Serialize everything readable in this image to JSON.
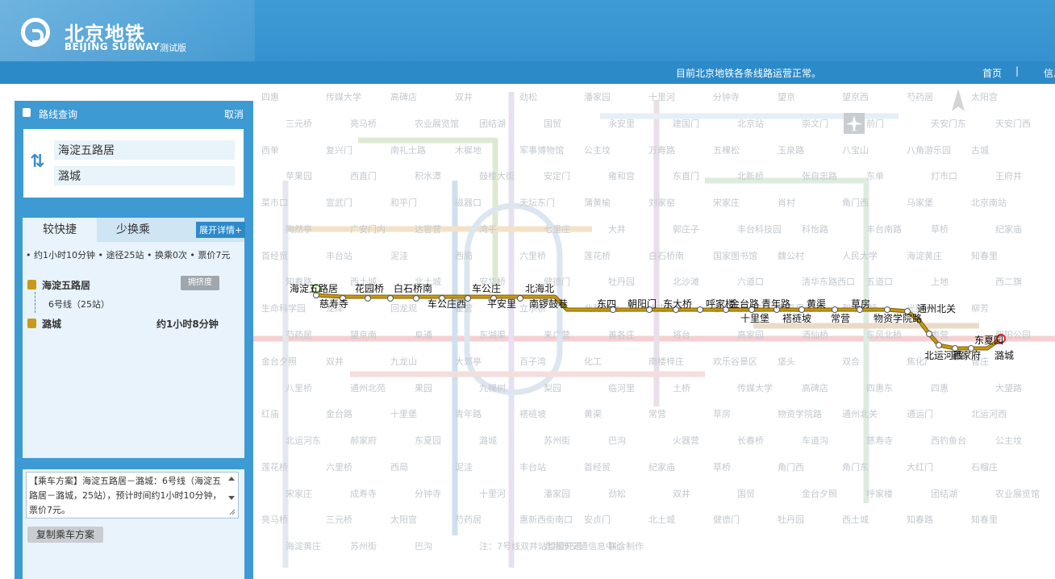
{
  "header": {
    "logo_cn": "北京地铁",
    "logo_en": "BEIJING SUBWAY",
    "logo_beta": "测试版",
    "status": "目前北京地铁各条线路运营正常。",
    "nav": {
      "home": "首页",
      "separator": "|",
      "info": "信息"
    }
  },
  "sidebar": {
    "title": "路线查询",
    "cancel": "取消",
    "from_value": "海淀五路居",
    "to_value": "潞城",
    "tabs": [
      {
        "label": "较快捷"
      },
      {
        "label": "少换乘"
      }
    ],
    "expand": "展开详情+",
    "summary": "• 约1小时10分钟 • 途径25站 • 换乘0次 • 票价7元",
    "route": {
      "from": "海淀五路居",
      "crowd": "拥挤度",
      "line": "6号线（25站）",
      "to": "潞城",
      "duration": "约1小时8分钟"
    },
    "plan_text": "【乘车方案】海淀五路居－潞城：6号线（海淀五路居－潞城，25站），预计时间约1小时10分钟，票价7元。",
    "copy_button": "复制乘车方案"
  },
  "map": {
    "line_color": "#c49a14",
    "stations": [
      "海淀五路居",
      "慈寿寺",
      "花园桥",
      "白石桥南",
      "车公庄西",
      "车公庄",
      "平安里",
      "北海北",
      "南锣鼓巷",
      "东四",
      "朝阳门",
      "东大桥",
      "呼家楼",
      "金台路",
      "十里堡",
      "青年路",
      "褡裢坡",
      "黄渠",
      "常营",
      "草房",
      "物资学院路",
      "通州北关",
      "北运河西",
      "郝家府",
      "东夏园",
      "潞城"
    ],
    "background_labels": [
      "四惠",
      "传媒大学",
      "高碑店",
      "双井",
      "劲松",
      "潘家园",
      "十里河",
      "分钟寺",
      "望京",
      "望京西",
      "芍药居",
      "太阳宫",
      "三元桥",
      "亮马桥",
      "农业展览馆",
      "团结湖",
      "国贸",
      "永安里",
      "建国门",
      "北京站",
      "崇文门",
      "前门",
      "天安门东",
      "天安门西",
      "西单",
      "复兴门",
      "南礼士路",
      "木樨地",
      "军事博物馆",
      "公主坟",
      "万寿路",
      "五棵松",
      "玉泉路",
      "八宝山",
      "八角游乐园",
      "古城",
      "苹果园",
      "西直门",
      "积水潭",
      "鼓楼大街",
      "安定门",
      "雍和宫",
      "东直门",
      "北新桥",
      "张自忠路",
      "东单",
      "灯市口",
      "王府井",
      "菜市口",
      "宣武门",
      "和平门",
      "磁器口",
      "天坛东门",
      "蒲黄榆",
      "刘家窑",
      "宋家庄",
      "肖村",
      "角门西",
      "马家堡",
      "北京南站",
      "陶然亭",
      "广安门内",
      "达官营",
      "湾子",
      "七里庄",
      "大井",
      "郭庄子",
      "丰台科技园",
      "科怡路",
      "丰台南路",
      "草桥",
      "纪家庙",
      "首经贸",
      "丰台站",
      "泥洼",
      "西局",
      "六里桥",
      "莲花桥",
      "白石桥南",
      "国家图书馆",
      "魏公村",
      "人民大学",
      "海淀黄庄",
      "知春里",
      "知春路",
      "西土城",
      "北土城",
      "安华桥",
      "健德门",
      "牡丹园",
      "北沙滩",
      "六道口",
      "清华东路西口",
      "五道口",
      "上地",
      "西二旗",
      "生命科学园",
      "龙泽",
      "回龙观",
      "霍营",
      "立水桥",
      "北苑路北",
      "大屯路东",
      "惠新西街北口",
      "和平里北街",
      "和平西桥",
      "光熙门",
      "柳芳",
      "芍药居",
      "望京南",
      "阜通",
      "东湖渠",
      "来广营",
      "善各庄",
      "将台",
      "高家园",
      "酒仙桥",
      "东风北桥",
      "枣营",
      "朝阳公园",
      "金台夕照",
      "双井",
      "九龙山",
      "大郊亭",
      "百子湾",
      "化工",
      "南楼梓庄",
      "欢乐谷景区",
      "垡头",
      "双合",
      "焦化厂",
      "管庄",
      "八里桥",
      "通州北苑",
      "果园",
      "九棵树",
      "梨园",
      "临河里",
      "土桥",
      "传媒大学",
      "高碑店",
      "四惠东",
      "四惠",
      "大望路",
      "红庙",
      "金台路",
      "十里堡",
      "青年路",
      "褡裢坡",
      "黄渠",
      "常营",
      "草房",
      "物资学院路",
      "通州北关",
      "通运门",
      "北运河西",
      "北运河东",
      "郝家府",
      "东夏园",
      "潞城",
      "苏州街",
      "巴沟",
      "火器营",
      "长春桥",
      "车道沟",
      "慈寿寺",
      "西钓鱼台",
      "公主坟",
      "莲花桥",
      "六里桥",
      "西局",
      "泥洼",
      "丰台站",
      "首经贸",
      "纪家庙",
      "草桥",
      "角门西",
      "角门东",
      "大红门",
      "石榴庄",
      "宋家庄",
      "成寿寺",
      "分钟寺",
      "十里河",
      "潘家园",
      "劲松",
      "双井",
      "国贸",
      "金台夕照",
      "呼家楼",
      "团结湖",
      "农业展览馆",
      "亮马桥",
      "三元桥",
      "太阳宫",
      "芍药居",
      "惠新西街南口",
      "安贞门",
      "北土城",
      "健德门",
      "牡丹园",
      "西土城",
      "知春路",
      "知春里",
      "海淀黄庄",
      "苏州街",
      "巴沟",
      "注：7号线双井站暂缓开通",
      "北京市交通信息中心",
      "联合制作"
    ]
  }
}
